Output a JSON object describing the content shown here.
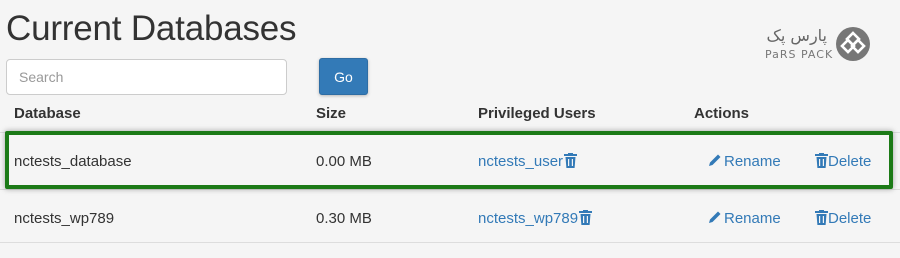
{
  "page": {
    "title": "Current Databases"
  },
  "search": {
    "placeholder": "Search",
    "value": "",
    "go_label": "Go"
  },
  "logo": {
    "text_fa": "پارس پک",
    "text_en": "PaRS PACK"
  },
  "table": {
    "headers": [
      "Database",
      "Size",
      "Privileged Users",
      "Actions"
    ],
    "rows": [
      {
        "database": "nctests_database",
        "size": "0.00 MB",
        "user": "nctests_user",
        "rename": "Rename",
        "delete": "Delete"
      },
      {
        "database": "nctests_wp789",
        "size": "0.30 MB",
        "user": "nctests_wp789",
        "rename": "Rename",
        "delete": "Delete"
      }
    ]
  },
  "colors": {
    "accent": "#337ab7",
    "highlight": "#1c7a17"
  },
  "icons": {
    "trash": "trash-icon",
    "pencil": "pencil-icon",
    "logo": "parspack-logo-icon"
  }
}
